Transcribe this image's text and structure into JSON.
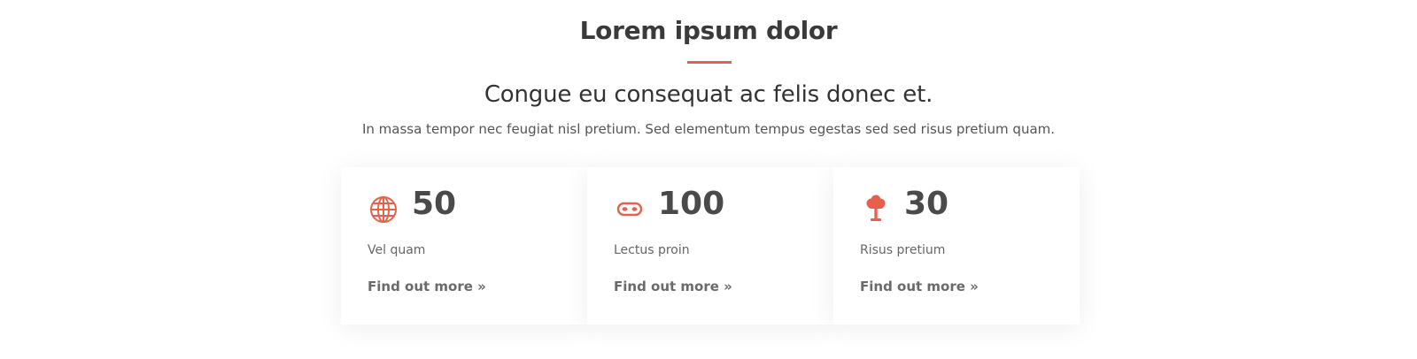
{
  "section": {
    "title": "Lorem ipsum dolor",
    "subtitle": "Congue eu consequat ac felis donec et.",
    "lead": "In massa tempor nec feugiat nisl pretium. Sed elementum tempus egestas sed sed risus pretium quam."
  },
  "colors": {
    "accent": "#e8604c",
    "heading": "#3a3a3a",
    "text": "#555555"
  },
  "cards": [
    {
      "icon": "globe-icon",
      "number": "50",
      "label": "Vel quam",
      "link": "Find out more »"
    },
    {
      "icon": "mask-icon",
      "number": "100",
      "label": "Lectus proin",
      "link": "Find out more »"
    },
    {
      "icon": "tree-icon",
      "number": "30",
      "label": "Risus pretium",
      "link": "Find out more »"
    }
  ]
}
